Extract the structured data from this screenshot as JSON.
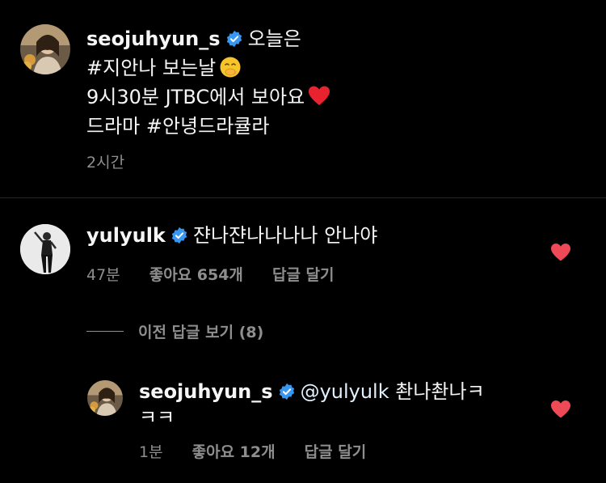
{
  "post": {
    "username": "seojuhyun_s",
    "caption_line1": "오늘은",
    "caption_line2": "#지안나 보는날",
    "caption_line3": "9시30분 JTBC에서 보아요",
    "caption_line4": "드라마 #안녕드라큘라",
    "time": "2시간",
    "emoji_line2": "face-with-hand-over-mouth",
    "emoji_line3": "red-heart"
  },
  "comments": [
    {
      "username": "yulyulk",
      "text": "쟌나쟌나나나나 안나야",
      "time": "47분",
      "likes": "좋아요 654개",
      "reply_label": "답글 달기"
    }
  ],
  "view_previous_replies": "이전 답글 보기 (8)",
  "reply": {
    "username": "seojuhyun_s",
    "mention": "@yulyulk",
    "text": "촨나촨나ㅋ",
    "text_line2": "ㅋㅋ",
    "time": "1분",
    "likes": "좋아요 12개",
    "reply_label": "답글 달기"
  },
  "colors": {
    "background": "#000000",
    "text": "#f5f5f5",
    "secondary": "#8e8e8e",
    "verified": "#3897f0",
    "heart": "#ed4956"
  }
}
